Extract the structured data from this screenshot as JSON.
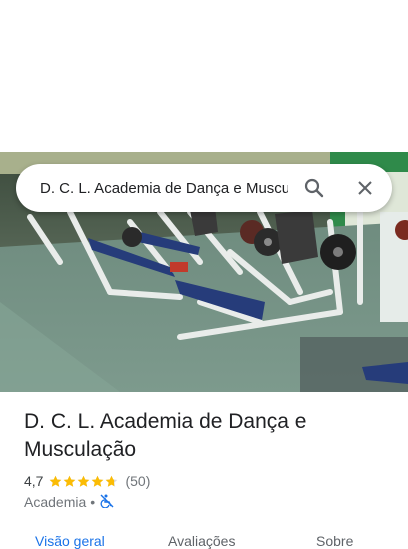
{
  "search": {
    "query": "D. C. L. Academia de Dança e Musculação"
  },
  "place": {
    "name": "D. C. L. Academia de Dança e Musculação",
    "rating": "4,7",
    "stars_filled": 4.7,
    "review_count": "(50)",
    "category": "Academia",
    "separator": "•",
    "accessibility_icon": "no-wheelchair-icon"
  },
  "tabs": [
    {
      "label": "Visão geral",
      "active": true
    },
    {
      "label": "Avaliações",
      "active": false
    },
    {
      "label": "Sobre",
      "active": false
    }
  ],
  "colors": {
    "accent": "#1a73e8",
    "star": "#fbbc04",
    "text_primary": "#202124",
    "text_secondary": "#70757a"
  }
}
